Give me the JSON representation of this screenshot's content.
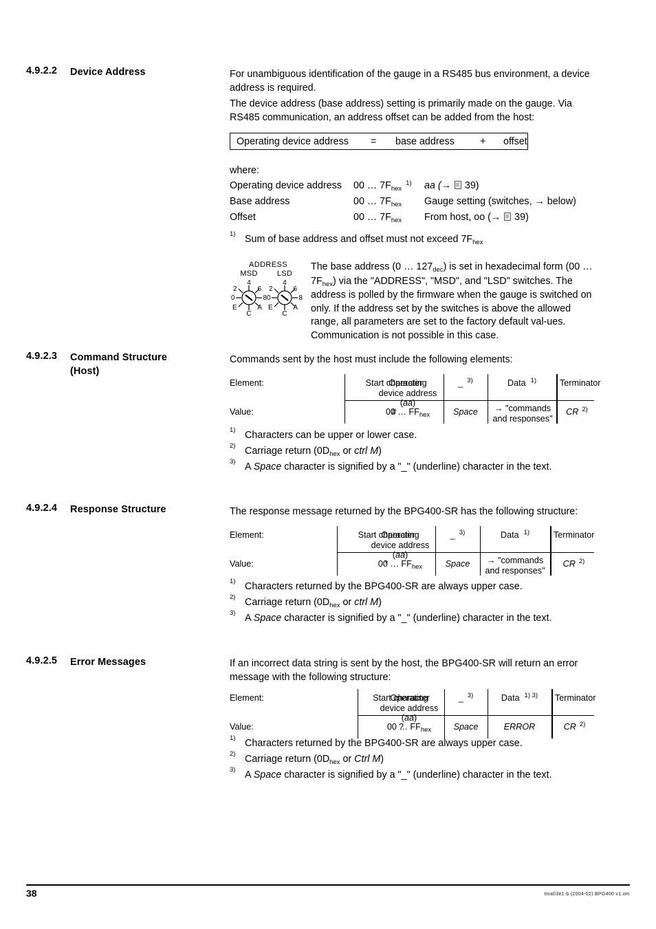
{
  "sections": {
    "device_address": {
      "number": "4.9.2.2",
      "title": "Device Address",
      "para1": "For unambiguous identification of the gauge in a RS485 bus environment, a device address is required.",
      "para2": "The device address (base address) setting is primarily made on the gauge. Via RS485 communication, an address offset can be added from the host:",
      "formula": {
        "lhs": "Operating device address",
        "equals": "=",
        "base": "base address",
        "plus": "+",
        "offset": "offset"
      },
      "where_label": "where:",
      "where_rows": [
        {
          "name": "Operating device address",
          "value_prefix": "00 … 7F",
          "value_sub": "hex",
          "marker": "1)",
          "note_pre": "aa (→ ",
          "note_post": " 39)"
        },
        {
          "name": "Base address",
          "value_prefix": "00 … 7F",
          "value_sub": "hex",
          "marker": "",
          "note_plain": "Gauge setting (switches, → below)"
        },
        {
          "name": "Offset",
          "value_prefix": "00 … 7F",
          "value_sub": "hex",
          "marker": "",
          "note_pre": "From host, oo (→ ",
          "note_post": " 39)"
        }
      ],
      "footnote": {
        "marker": "1)",
        "text_pre": "Sum of base address and offset must not exceed 7F",
        "text_sub": "hex"
      },
      "switch_figure": {
        "title": "ADDRESS",
        "msd_label": "MSD",
        "lsd_label": "LSD",
        "tick_labels": [
          "0",
          "2",
          "4",
          "6",
          "8",
          "A",
          "C",
          "E"
        ]
      },
      "switch_para": "The base address (0 … 127dec) is set in hexadecimal form (00 … 7Fhex) via the \"ADDRESS\", \"MSD\", and \"LSD\" switches. The address is polled by the firmware when the gauge is switched on only. If the address set by the switches is above the allowed range, all parameters are set to the factory default values. Communication is not possible in this case."
    },
    "command_structure": {
      "number": "4.9.2.3",
      "title_line1": "Command Structure",
      "title_line2": "(Host)",
      "intro": "Commands sent by the host must include the following elements:",
      "table": {
        "row_labels": [
          "Element:",
          "Value:"
        ],
        "headers": {
          "start_character": "Start character",
          "operating_line1": "Operating",
          "operating_line2_pre": "device address (",
          "operating_line2_it": "aa",
          "operating_line2_post": ")",
          "underscore": "_",
          "underscore_marker": "3)",
          "data": "Data",
          "data_marker": "1)",
          "terminator": "Terminator"
        },
        "values": {
          "start_character": "#",
          "address_pre": "00 … FF",
          "address_sub": "hex",
          "space": "Space",
          "data_line1": "→ \"commands",
          "data_line2": "and responses\"",
          "terminator": "CR",
          "terminator_marker": "2)"
        }
      },
      "footnotes": [
        {
          "marker": "1)",
          "text": "Characters can be upper or lower case."
        },
        {
          "marker": "2)",
          "pre": "Carriage return (0D",
          "sub": "hex",
          "mid": " or ",
          "it": "ctrl M",
          "post": ")"
        },
        {
          "marker": "3)",
          "pre": "A ",
          "it": "Space",
          "post": " character is signified by a \"_\" (underline) character in the text."
        }
      ]
    },
    "response_structure": {
      "number": "4.9.2.4",
      "title": "Response Structure",
      "intro": "The response message returned by the BPG400-SR has the following structure:",
      "table": {
        "row_labels": [
          "Element:",
          "Value:"
        ],
        "headers": {
          "start_character": "Start character",
          "operating_line1": "Operating",
          "operating_line2_pre": "device address (",
          "operating_line2_it": "aa",
          "operating_line2_post": ")",
          "underscore": "_",
          "underscore_marker": "3)",
          "data": "Data",
          "data_marker": "1)",
          "terminator": "Terminator"
        },
        "values": {
          "start_character": "*",
          "address_pre": "00 … FF",
          "address_sub": "hex",
          "space": "Space",
          "data_line1": "→ \"commands",
          "data_line2": "and responses\"",
          "terminator": "CR",
          "terminator_marker": "2)"
        }
      },
      "footnotes": [
        {
          "marker": "1)",
          "text": "Characters returned by the BPG400-SR are always upper case."
        },
        {
          "marker": "2)",
          "pre": "Carriage return (0D",
          "sub": "hex",
          "mid": " or ",
          "it": "ctrl M",
          "post": ")"
        },
        {
          "marker": "3)",
          "pre": "A ",
          "it": "Space",
          "post": " character is signified by a \"_\" (underline) character in the text."
        }
      ]
    },
    "error_messages": {
      "number": "4.9.2.5",
      "title": "Error Messages",
      "intro": "If an incorrect data string is sent by the host, the BPG400-SR will return an error message with the following structure:",
      "table": {
        "row_labels": [
          "Element:",
          "Value:"
        ],
        "headers": {
          "start_character": "Start character",
          "operating_line1": "Operating",
          "operating_line2_pre": "device address (",
          "operating_line2_it": "aa",
          "operating_line2_post": ")",
          "underscore": "_",
          "underscore_marker": "3)",
          "data": "Data",
          "data_marker": "1) 3)",
          "terminator": "Terminator"
        },
        "values": {
          "start_character": "?",
          "address_pre": "00 … FF",
          "address_sub": "hex",
          "space": "Space",
          "data_line1": "ERROR",
          "data_line2": "",
          "terminator": "CR",
          "terminator_marker": "2)"
        }
      },
      "footnotes": [
        {
          "marker": "1)",
          "text": "Characters returned by the BPG400-SR are always upper case."
        },
        {
          "marker": "2)",
          "pre": "Carriage return (0D",
          "sub": "hex",
          "mid": " or ",
          "it": "Ctrl M",
          "post": ")"
        },
        {
          "marker": "3)",
          "pre": "A ",
          "it": "Space",
          "post": " character is signified by a \"_\" (underline) character in the text."
        }
      ]
    }
  },
  "footer": {
    "page_number": "38",
    "document_code": "tina03e1-b   (2004-02)   BPG400 v1.om"
  }
}
